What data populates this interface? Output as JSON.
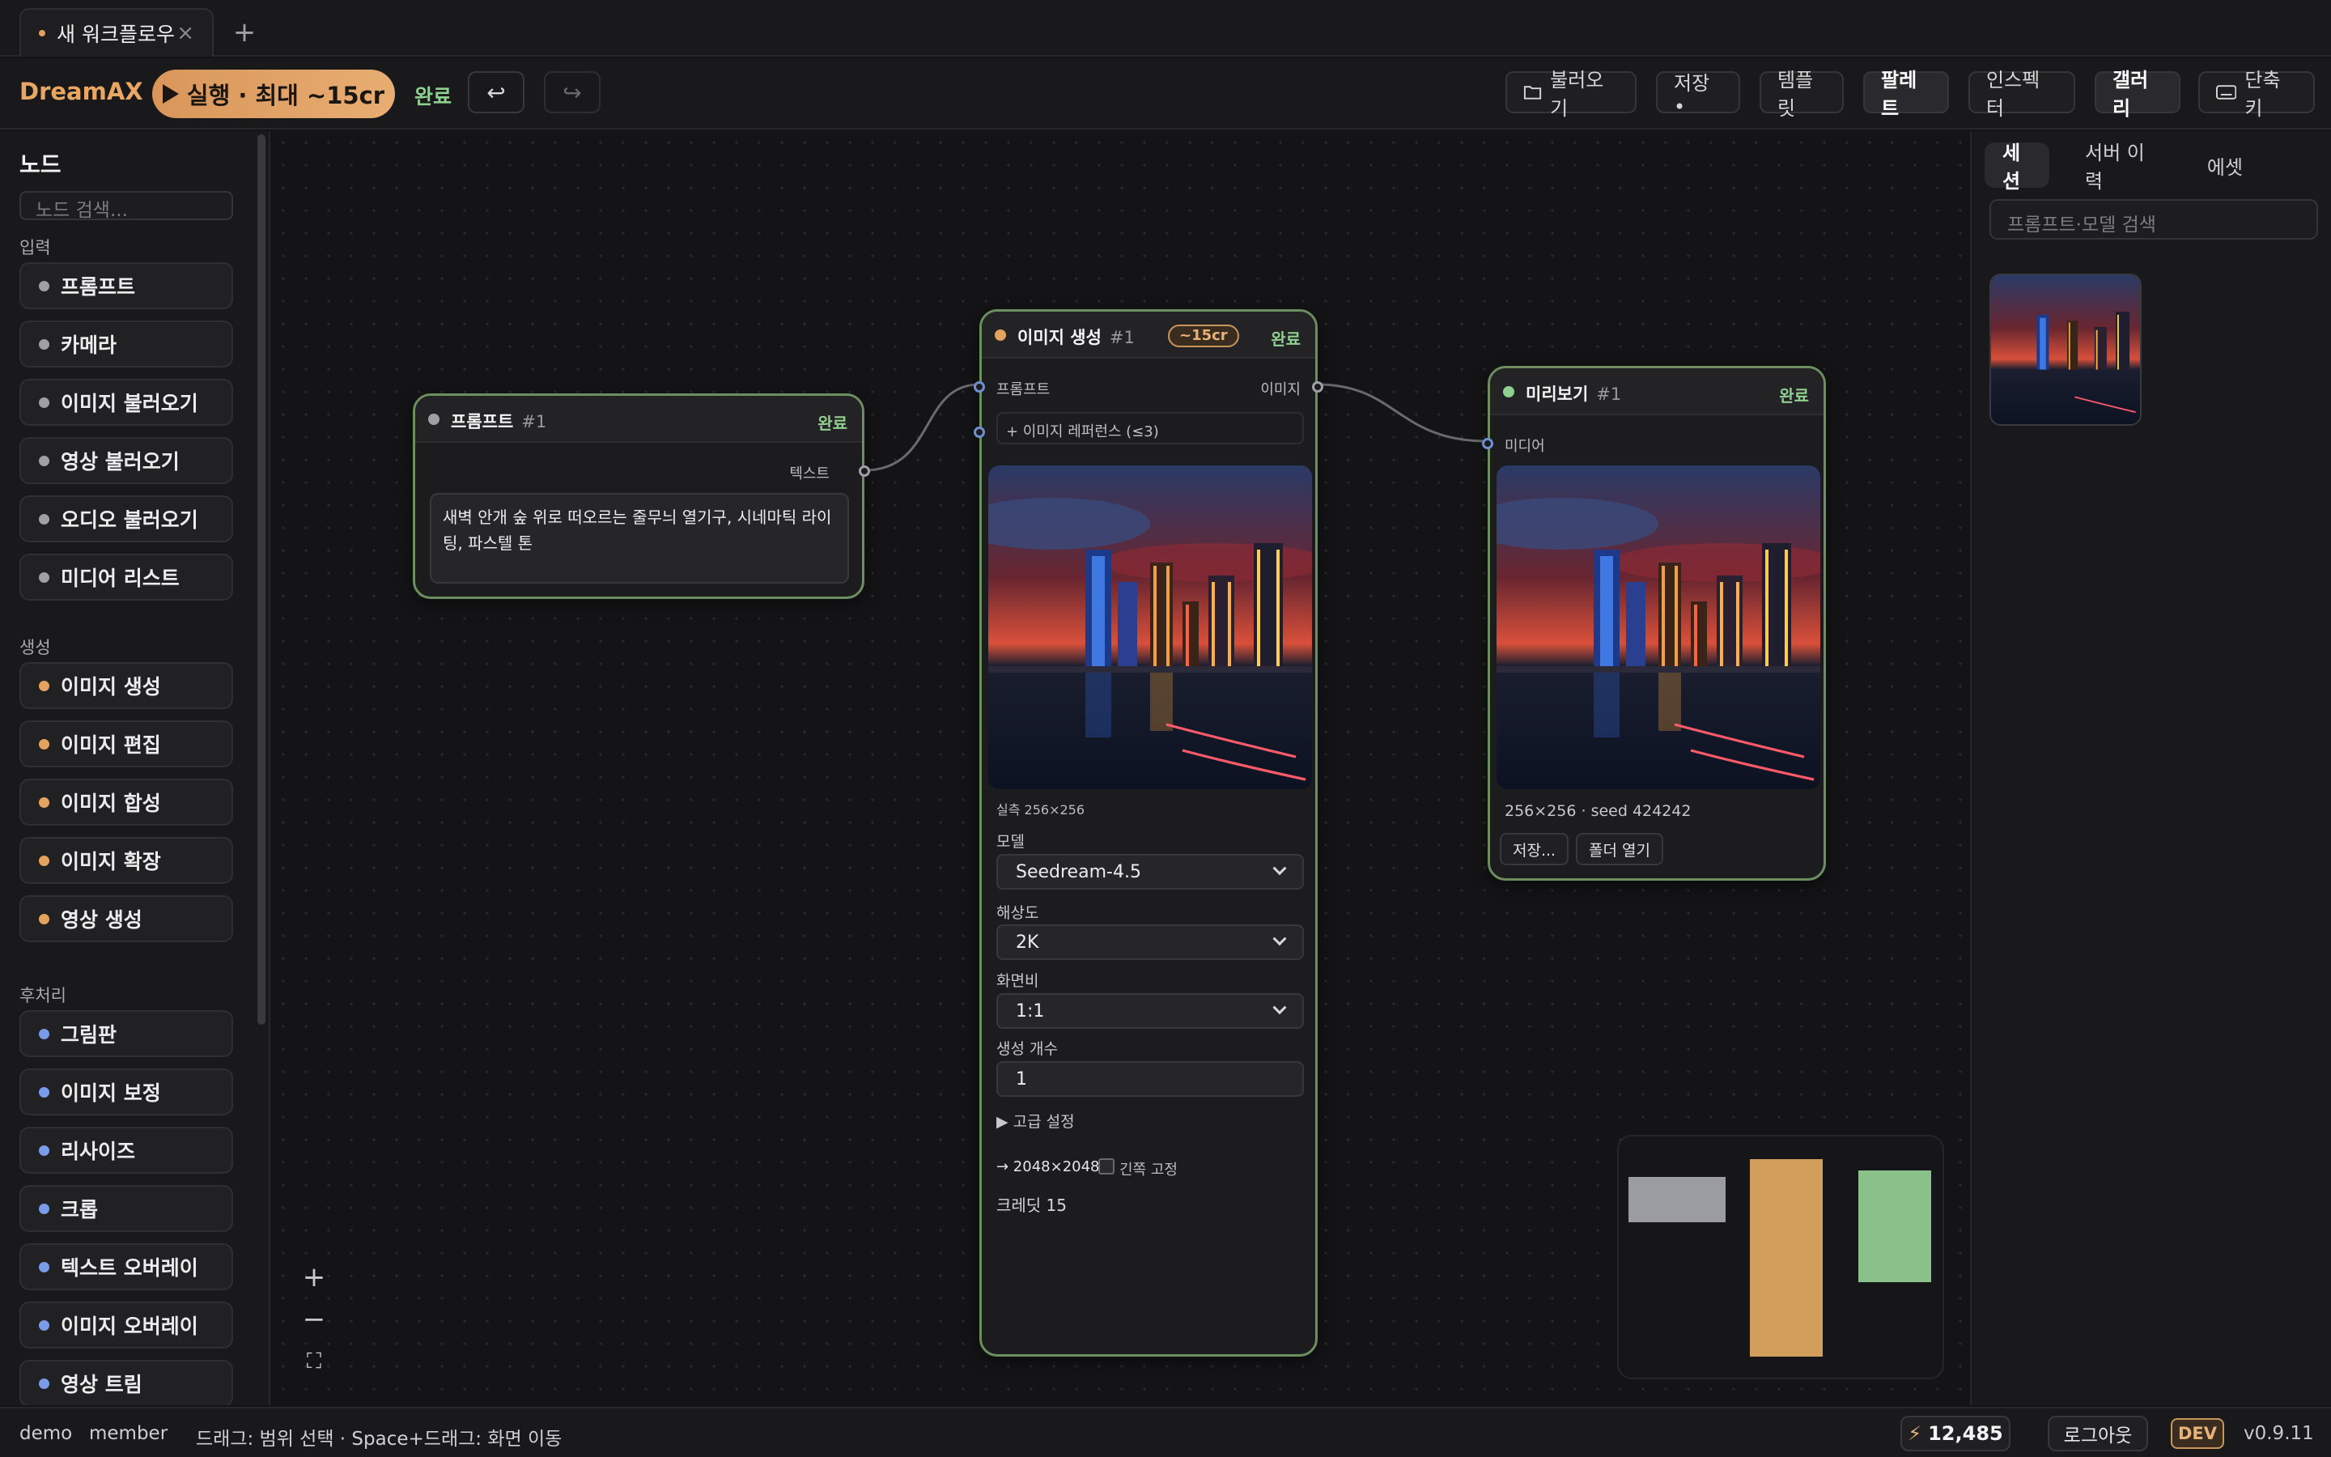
{
  "tab": {
    "title": "새 워크플로우",
    "close": "×",
    "new_tab": "+"
  },
  "toolbar": {
    "brand": "DreamAX",
    "run_label": "실행 · 최대 ~15cr",
    "status": "완료",
    "undo_icon": "↩",
    "redo_icon": "↪",
    "buttons": {
      "load": "불러오기",
      "save": "저장 •",
      "template": "템플릿",
      "palette": "팔레트",
      "inspector": "인스펙터",
      "gallery": "갤러리",
      "shortcuts": "단축키"
    }
  },
  "sidebar": {
    "title": "노드",
    "search_placeholder": "노드 검색...",
    "groups": [
      {
        "label": "입력",
        "color": "#a0a0a4",
        "items": [
          "프롬프트",
          "카메라",
          "이미지 불러오기",
          "영상 불러오기",
          "오디오 불러오기",
          "미디어 리스트"
        ]
      },
      {
        "label": "생성",
        "color": "#e3a25e",
        "items": [
          "이미지 생성",
          "이미지 편집",
          "이미지 합성",
          "이미지 확장",
          "영상 생성"
        ]
      },
      {
        "label": "후처리",
        "color": "#7a9be8",
        "items": [
          "그림판",
          "이미지 보정",
          "리사이즈",
          "크롭",
          "텍스트 오버레이",
          "이미지 오버레이",
          "영상 트림"
        ]
      }
    ]
  },
  "nodes": {
    "prompt": {
      "title": "프롬프트",
      "id": "#1",
      "state": "완료",
      "output_label": "텍스트",
      "text": "새벽 안개 숲 위로 떠오르는 줄무늬 열기구, 시네마틱 라이팅, 파스텔 톤"
    },
    "generate": {
      "title": "이미지 생성",
      "id": "#1",
      "cost": "~15cr",
      "state": "완료",
      "in_prompt": "프롬프트",
      "out_image": "이미지",
      "reference": "+ 이미지 레퍼런스 (≤3)",
      "actual_size": "실측 256×256",
      "model_label": "모델",
      "model_value": "Seedream-4.5",
      "resolution_label": "해상도",
      "resolution_value": "2K",
      "aspect_label": "화면비",
      "aspect_value": "1:1",
      "count_label": "생성 개수",
      "count_value": "1",
      "advanced": "▶ 고급 설정",
      "output_size": "→ 2048×2048",
      "lock_ratio": "긴쪽 고정",
      "credit": "크레딧 15"
    },
    "preview": {
      "title": "미리보기",
      "id": "#1",
      "state": "완료",
      "in_media": "미디어",
      "meta": "256×256 · seed 424242",
      "save_btn": "저장...",
      "open_folder_btn": "폴더 열기"
    }
  },
  "canvas": {
    "zoom_in": "+",
    "zoom_out": "−",
    "fit": "⛶"
  },
  "minimap": {
    "colors": [
      "#9a9ca2",
      "#d19e5c",
      "#8ac08a"
    ]
  },
  "right_panel": {
    "tabs": [
      "세션",
      "서버 이력",
      "에셋"
    ],
    "active_tab": "세션",
    "search_placeholder": "프롬프트·모델 검색"
  },
  "statusbar": {
    "user": "demo",
    "role": "member",
    "hint": "드래그: 범위 선택 · Space+드래그: 화면 이동",
    "credits": "12,485",
    "logout": "로그아웃",
    "env": "DEV",
    "version": "v0.9.11"
  },
  "colors": {
    "accent": "#e8a763",
    "done": "#8fcf8f",
    "node_border": "#6d8f60",
    "input_port": "#7a9be8"
  }
}
